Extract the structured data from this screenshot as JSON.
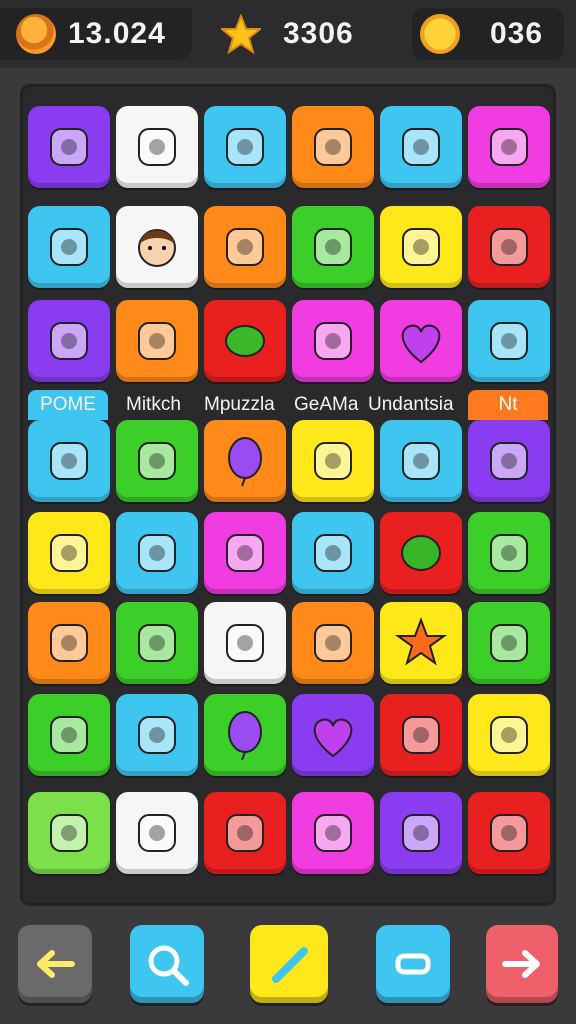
{
  "hud": {
    "coins": "13.024",
    "stars": "3306",
    "suns": "036"
  },
  "hud_icons": [
    "coin-icon",
    "star-icon",
    "sun-icon"
  ],
  "labels": {
    "l1": "POME",
    "l2": "Mitkch",
    "l3": "Mpuzzla",
    "l4": "GeAMa",
    "l5": "Undantsia",
    "l6": "Nt"
  },
  "board": {
    "rows": [
      [
        {
          "icon": "ring-icon",
          "color": "#8a3cf0"
        },
        {
          "icon": "robot-heart-icon",
          "color": "#f6f6f6"
        },
        {
          "icon": "hammer-icon",
          "color": "#3ec5f0"
        },
        {
          "icon": "card-icon",
          "color": "#ff8a1a"
        },
        {
          "icon": "ghost-icon",
          "color": "#3ec5f0"
        },
        {
          "icon": "wand-icon",
          "color": "#f03ce0"
        }
      ],
      [
        {
          "icon": "bird-icon",
          "color": "#3ec5f0"
        },
        {
          "icon": "face-icon",
          "color": "#f6f6f6"
        },
        {
          "icon": "eyes-icon",
          "color": "#ff8a1a"
        },
        {
          "icon": "dino-icon",
          "color": "#3ccf2a"
        },
        {
          "icon": "block-icon",
          "color": "#ffe81a"
        },
        {
          "icon": "spiral-icon",
          "color": "#e82020"
        }
      ],
      [
        {
          "icon": "fish-icon",
          "color": "#8a3cf0"
        },
        {
          "icon": "tree-icon",
          "color": "#ff8a1a"
        },
        {
          "icon": "leaf-icon",
          "color": "#e82020"
        },
        {
          "icon": "book-icon",
          "color": "#f03ce0"
        },
        {
          "icon": "heart-icon",
          "color": "#f03ce0"
        },
        {
          "icon": "flower-icon",
          "color": "#3ec5f0"
        }
      ],
      [
        {
          "icon": "monster-icon",
          "color": "#3ec5f0"
        },
        {
          "icon": "cat-icon",
          "color": "#3ccf2a"
        },
        {
          "icon": "balloon-icon",
          "color": "#ff8a1a"
        },
        {
          "icon": "gear-icon",
          "color": "#ffe81a"
        },
        {
          "icon": "clown-icon",
          "color": "#3ec5f0"
        },
        {
          "icon": "bear-icon",
          "color": "#8a3cf0"
        }
      ],
      [
        {
          "icon": "gem-icon",
          "color": "#ffe81a"
        },
        {
          "icon": "rocket-icon",
          "color": "#3ec5f0"
        },
        {
          "icon": "target-icon",
          "color": "#f03ce0"
        },
        {
          "icon": "marker-icon",
          "color": "#3ec5f0"
        },
        {
          "icon": "lime-icon",
          "color": "#e82020"
        },
        {
          "icon": "arrow-icon",
          "color": "#3ccf2a"
        }
      ],
      [
        {
          "icon": "gift-icon",
          "color": "#ff8a1a"
        },
        {
          "icon": "chick-icon",
          "color": "#3ccf2a"
        },
        {
          "icon": "crate-icon",
          "color": "#f6f6f6"
        },
        {
          "icon": "sun-icon",
          "color": "#ff8a1a"
        },
        {
          "icon": "star-icon",
          "color": "#ffe81a"
        },
        {
          "icon": "heart-box-icon",
          "color": "#3ccf2a"
        }
      ],
      [
        {
          "icon": "star-wand-icon",
          "color": "#3ccf2a"
        },
        {
          "icon": "frame-icon",
          "color": "#3ec5f0"
        },
        {
          "icon": "balloon-icon",
          "color": "#3ccf2a"
        },
        {
          "icon": "heart-icon",
          "color": "#8a3cf0"
        },
        {
          "icon": "camera-icon",
          "color": "#e82020"
        },
        {
          "icon": "pink-star-icon",
          "color": "#ffe81a"
        }
      ],
      [
        {
          "icon": "alien-icon",
          "color": "#7ce04a"
        },
        {
          "icon": "owl-icon",
          "color": "#f6f6f6"
        },
        {
          "icon": "cookie-icon",
          "color": "#e82020"
        },
        {
          "icon": "bag-icon",
          "color": "#f03ce0"
        },
        {
          "icon": "drop-icon",
          "color": "#8a3cf0"
        },
        {
          "icon": "smile-icon",
          "color": "#e82020"
        }
      ]
    ]
  },
  "nav": [
    {
      "icon": "back-arrow-icon",
      "color": "#6a6a6c"
    },
    {
      "icon": "search-icon",
      "color": "#3ec5f0"
    },
    {
      "icon": "pencil-icon",
      "color": "#ffe81a"
    },
    {
      "icon": "minimize-icon",
      "color": "#3ec5f0"
    },
    {
      "icon": "forward-arrow-icon",
      "color": "#f0606a"
    }
  ]
}
